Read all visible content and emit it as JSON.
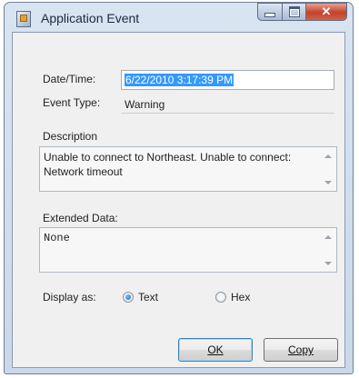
{
  "window": {
    "title": "Application Event"
  },
  "fields": {
    "datetime_label": "Date/Time:",
    "datetime_value": "6/22/2010 3:17:39 PM",
    "event_type_label": "Event Type:",
    "event_type_value": "Warning",
    "description_label": "Description",
    "description_value": "Unable to connect to Northeast. Unable to connect: Network timeout",
    "extended_label": "Extended Data:",
    "extended_value": "None"
  },
  "display": {
    "label": "Display as:",
    "options": [
      "Text",
      "Hex"
    ],
    "selected": "Text"
  },
  "buttons": {
    "ok": "OK",
    "copy": "Copy"
  }
}
